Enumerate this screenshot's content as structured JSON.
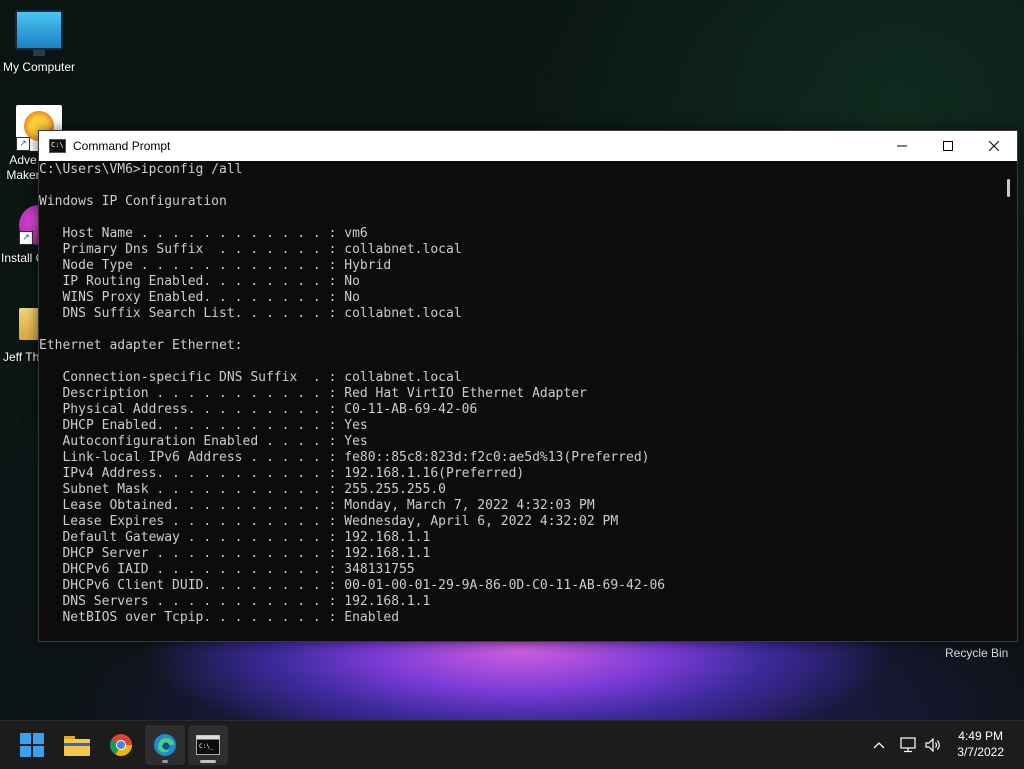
{
  "desktop": {
    "icons": [
      {
        "label": "My Computer"
      },
      {
        "label": "Adve Maker"
      },
      {
        "label": "Install C"
      },
      {
        "label": "Jeff Th"
      }
    ],
    "recycle_bin": "Recycle Bin"
  },
  "window": {
    "title": "Command Prompt",
    "lines": [
      "C:\\Users\\VM6>ipconfig /all",
      "",
      "Windows IP Configuration",
      "",
      "   Host Name . . . . . . . . . . . . : vm6",
      "   Primary Dns Suffix  . . . . . . . : collabnet.local",
      "   Node Type . . . . . . . . . . . . : Hybrid",
      "   IP Routing Enabled. . . . . . . . : No",
      "   WINS Proxy Enabled. . . . . . . . : No",
      "   DNS Suffix Search List. . . . . . : collabnet.local",
      "",
      "Ethernet adapter Ethernet:",
      "",
      "   Connection-specific DNS Suffix  . : collabnet.local",
      "   Description . . . . . . . . . . . : Red Hat VirtIO Ethernet Adapter",
      "   Physical Address. . . . . . . . . : C0-11-AB-69-42-06",
      "   DHCP Enabled. . . . . . . . . . . : Yes",
      "   Autoconfiguration Enabled . . . . : Yes",
      "   Link-local IPv6 Address . . . . . : fe80::85c8:823d:f2c0:ae5d%13(Preferred)",
      "   IPv4 Address. . . . . . . . . . . : 192.168.1.16(Preferred)",
      "   Subnet Mask . . . . . . . . . . . : 255.255.255.0",
      "   Lease Obtained. . . . . . . . . . : Monday, March 7, 2022 4:32:03 PM",
      "   Lease Expires . . . . . . . . . . : Wednesday, April 6, 2022 4:32:02 PM",
      "   Default Gateway . . . . . . . . . : 192.168.1.1",
      "   DHCP Server . . . . . . . . . . . : 192.168.1.1",
      "   DHCPv6 IAID . . . . . . . . . . . : 348131755",
      "   DHCPv6 Client DUID. . . . . . . . : 00-01-00-01-29-9A-86-0D-C0-11-AB-69-42-06",
      "   DNS Servers . . . . . . . . . . . : 192.168.1.1",
      "   NetBIOS over Tcpip. . . . . . . . : Enabled"
    ]
  },
  "taskbar": {
    "items": [
      {
        "icon": "windows-start-icon"
      },
      {
        "icon": "file-explorer-icon"
      },
      {
        "icon": "chrome-icon"
      },
      {
        "icon": "edge-icon"
      },
      {
        "icon": "command-prompt-icon"
      }
    ],
    "clock": {
      "time": "4:49 PM",
      "date": "3/7/2022"
    }
  },
  "colors": {
    "console_bg": "#0c0c0c",
    "console_text": "#cccccc",
    "taskbar_bg": "#1c1c1c"
  }
}
